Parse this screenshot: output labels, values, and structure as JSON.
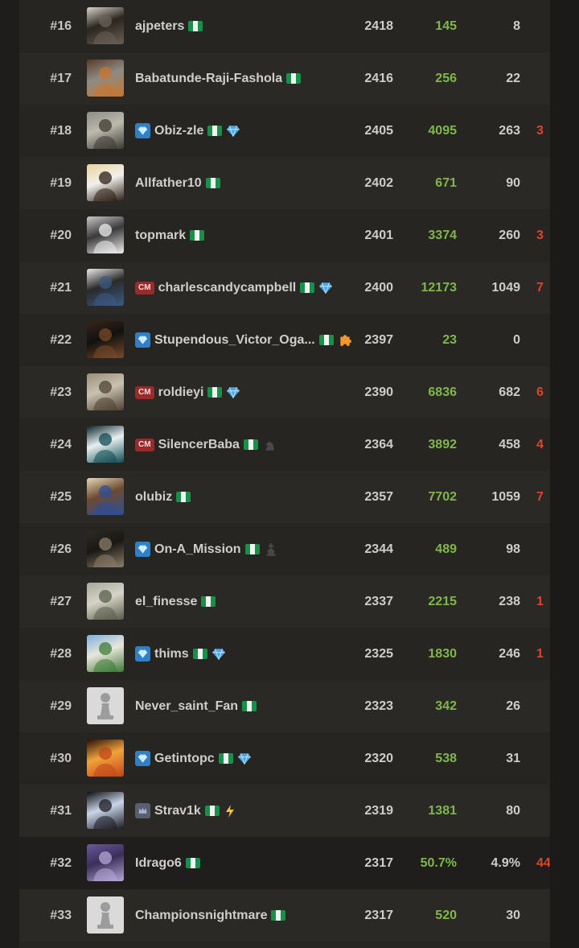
{
  "colors": {
    "won": "#81b64c",
    "lost": "#e0422c",
    "row_odd": "#2a2926",
    "row_even": "#262522"
  },
  "rows": [
    {
      "rank": "#16",
      "username": "ajpeters",
      "badge": "",
      "trail": "",
      "rating": "2418",
      "won": "145",
      "drawn": "8",
      "lost": "",
      "avatar": "photo-man-white-shirt",
      "avcolors": [
        "#d9d4c9",
        "#6a6155",
        "#2b2520"
      ]
    },
    {
      "rank": "#17",
      "username": "Babatunde-Raji-Fashola",
      "badge": "",
      "trail": "",
      "rating": "2416",
      "won": "256",
      "drawn": "22",
      "lost": "",
      "avatar": "photo-food-laptop",
      "avcolors": [
        "#5b3b26",
        "#c7762d",
        "#8d8b86"
      ]
    },
    {
      "rank": "#18",
      "username": "Obiz-zle",
      "badge": "diamond",
      "trail": "diamond",
      "rating": "2405",
      "won": "4095",
      "drawn": "263",
      "lost": "3",
      "avatar": "photo-man-sitting",
      "avcolors": [
        "#8b8d84",
        "#3d3a33",
        "#bdb9ad"
      ]
    },
    {
      "rank": "#19",
      "username": "Allfather10",
      "badge": "",
      "trail": "",
      "rating": "2402",
      "won": "671",
      "drawn": "90",
      "lost": "",
      "avatar": "photo-man-mask",
      "avcolors": [
        "#e8d39b",
        "#2c1e14",
        "#f2f0ec"
      ]
    },
    {
      "rank": "#20",
      "username": "topmark",
      "badge": "",
      "trail": "",
      "rating": "2401",
      "won": "3374",
      "drawn": "260",
      "lost": "3",
      "avatar": "photo-white-shirt",
      "avcolors": [
        "#c9c9c9",
        "#efefef",
        "#3a3a3a"
      ]
    },
    {
      "rank": "#21",
      "username": "charlescandycampbell",
      "badge": "cm",
      "trail": "diamond",
      "rating": "2400",
      "won": "12173",
      "drawn": "1049",
      "lost": "7",
      "avatar": "photo-man-stripes",
      "avcolors": [
        "#e9e9e9",
        "#3b5a86",
        "#2a2a2a"
      ]
    },
    {
      "rank": "#22",
      "username": "Stupendous_Victor_Oga...",
      "badge": "diamond",
      "trail": "puzzle",
      "rating": "2397",
      "won": "23",
      "drawn": "0",
      "lost": "",
      "avatar": "photo-muscles",
      "avcolors": [
        "#3a2518",
        "#7a4a2a",
        "#111111"
      ]
    },
    {
      "rank": "#23",
      "username": "roldieyi",
      "badge": "cm",
      "trail": "diamond",
      "rating": "2390",
      "won": "6836",
      "drawn": "682",
      "lost": "6",
      "avatar": "photo-woman-tree",
      "avcolors": [
        "#9a8f77",
        "#4f4132",
        "#c9c2b0"
      ]
    },
    {
      "rank": "#24",
      "username": "SilencerBaba",
      "badge": "cm",
      "trail": "knight",
      "rating": "2364",
      "won": "3892",
      "drawn": "458",
      "lost": "4",
      "avatar": "photo-hooded-figure",
      "avcolors": [
        "#0a2228",
        "#0d4b52",
        "#e8f0f0"
      ]
    },
    {
      "rank": "#25",
      "username": "olubiz",
      "badge": "",
      "trail": "",
      "rating": "2357",
      "won": "7702",
      "drawn": "1059",
      "lost": "7",
      "avatar": "photo-man-blue",
      "avcolors": [
        "#e6d7b8",
        "#2d4f97",
        "#6b4a32"
      ]
    },
    {
      "rank": "#26",
      "username": "On-A_Mission",
      "badge": "diamond",
      "trail": "king",
      "rating": "2344",
      "won": "489",
      "drawn": "98",
      "lost": "",
      "avatar": "photo-chess-board",
      "avcolors": [
        "#2e2a24",
        "#8b7e6a",
        "#1a1814"
      ]
    },
    {
      "rank": "#27",
      "username": "el_finesse",
      "badge": "",
      "trail": "",
      "rating": "2337",
      "won": "2215",
      "drawn": "238",
      "lost": "1",
      "avatar": "photo-chess-players",
      "avcolors": [
        "#a8a79c",
        "#5a5d4a",
        "#d6d4c8"
      ]
    },
    {
      "rank": "#28",
      "username": "thims",
      "badge": "diamond",
      "trail": "diamond",
      "rating": "2325",
      "won": "1830",
      "drawn": "246",
      "lost": "1",
      "avatar": "photo-garden-chess",
      "avcolors": [
        "#7fb0d8",
        "#3c7a34",
        "#e9e6dc"
      ]
    },
    {
      "rank": "#29",
      "username": "Never_saint_Fan",
      "badge": "",
      "trail": "",
      "rating": "2323",
      "won": "342",
      "drawn": "26",
      "lost": "",
      "avatar": "pawn",
      "avcolors": [
        "#dadada",
        "#9a9a9a",
        "#ffffff"
      ]
    },
    {
      "rank": "#30",
      "username": "Getintopc",
      "badge": "diamond",
      "trail": "diamond",
      "rating": "2320",
      "won": "538",
      "drawn": "31",
      "lost": "",
      "avatar": "photo-fire-demon",
      "avcolors": [
        "#2a0e08",
        "#c2451a",
        "#f1a33a"
      ]
    },
    {
      "rank": "#31",
      "username": "Strav1k",
      "badge": "crown",
      "trail": "bolt",
      "rating": "2319",
      "won": "1381",
      "drawn": "80",
      "lost": "",
      "avatar": "photo-s-logo",
      "avcolors": [
        "#0b0b0f",
        "#1b1b24",
        "#c9d6e8"
      ]
    },
    {
      "rank": "#32",
      "username": "Idrago6",
      "badge": "",
      "trail": "",
      "rating": "2317",
      "won": "50.7%",
      "drawn": "4.9%",
      "lost": "44",
      "avatar": "photo-purple-chess",
      "avcolors": [
        "#6a5a99",
        "#b6a7d8",
        "#3b2f58"
      ]
    },
    {
      "rank": "#33",
      "username": "Championsnightmare",
      "badge": "",
      "trail": "",
      "rating": "2317",
      "won": "520",
      "drawn": "30",
      "lost": "",
      "avatar": "pawn",
      "avcolors": [
        "#dadada",
        "#9a9a9a",
        "#ffffff"
      ]
    }
  ]
}
